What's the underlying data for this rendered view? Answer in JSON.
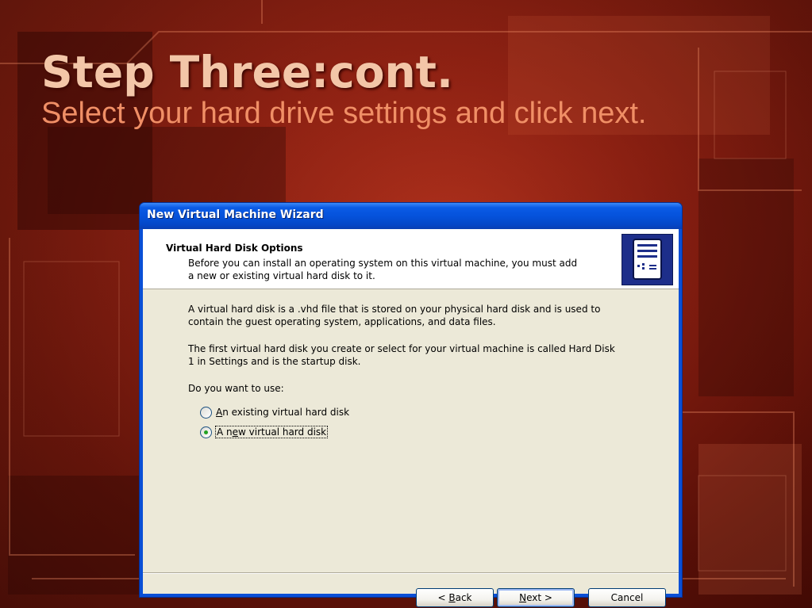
{
  "slide": {
    "title": "Step Three:cont.",
    "subtitle": "Select your hard drive settings and click next."
  },
  "window": {
    "title": "New Virtual Machine Wizard"
  },
  "header": {
    "title": "Virtual Hard Disk Options",
    "desc_line1": "Before you can install an operating system on this virtual machine, you must add",
    "desc_line2": "a new or existing virtual hard disk to it.",
    "icon": "server-icon"
  },
  "body": {
    "p1_line1": "A virtual hard disk is a .vhd file that is stored on your physical hard disk and is used to",
    "p1_line2": "contain the guest operating system, applications, and data files.",
    "p2_line1": "The first virtual hard disk you create or select for your virtual machine is called Hard Disk",
    "p2_line2": "1 in Settings and is the startup disk.",
    "question": "Do you want to use:"
  },
  "options": [
    {
      "mnemonic": "A",
      "rest": "n existing virtual hard disk",
      "selected": false
    },
    {
      "pre": "A n",
      "mnemonic": "e",
      "rest": "w virtual hard disk",
      "selected": true
    }
  ],
  "buttons": {
    "back_pre": "< ",
    "back_mnemonic": "B",
    "back_rest": "ack",
    "next_mnemonic": "N",
    "next_rest": "ext >",
    "cancel": "Cancel"
  },
  "colors": {
    "background_red": "#8a1d10",
    "title_color": "#f3c6a8",
    "subtitle_color": "#f08f66",
    "xp_blue": "#0552db",
    "dialog_face": "#ece9d8"
  }
}
